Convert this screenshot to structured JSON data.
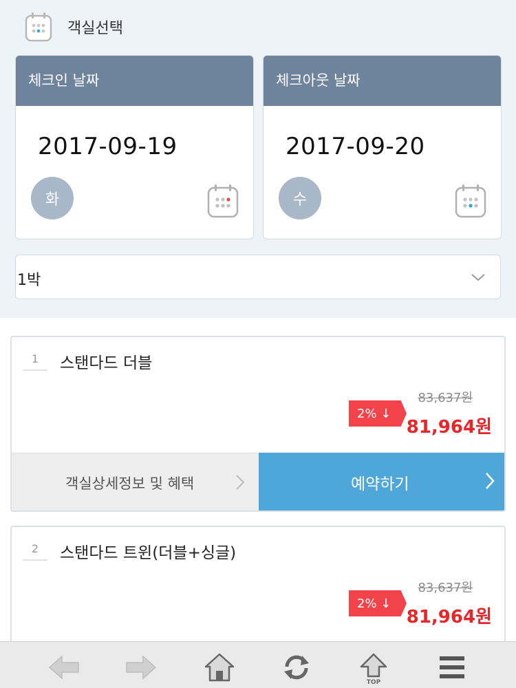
{
  "header": {
    "title": "객실선택",
    "icon": "calendar-icon"
  },
  "checkin": {
    "label": "체크인 날짜",
    "date": "2017-09-19",
    "weekday": "화"
  },
  "checkout": {
    "label": "체크아웃 날짜",
    "date": "2017-09-20",
    "weekday": "수"
  },
  "nights": {
    "selected": "1박"
  },
  "rooms": [
    {
      "number": "1",
      "name": "스탠다드 더블",
      "discount": "2% ↓",
      "original_price": "83,637원",
      "price": "81,964원",
      "detail_label": "객실상세정보 및 혜택",
      "reserve_label": "예약하기"
    },
    {
      "number": "2",
      "name": "스탠다드 트윈(더블+싱글)",
      "discount": "2% ↓",
      "original_price": "83,637원",
      "price": "81,964원"
    }
  ],
  "bottom_nav": {
    "top_label": "TOP",
    "icons": [
      "back-arrow-icon",
      "forward-arrow-icon",
      "home-icon",
      "refresh-icon",
      "top-arrow-icon",
      "menu-icon"
    ]
  },
  "colors": {
    "header_card": "#6e849c",
    "accent_blue": "#4fa6d9",
    "price_red": "#e5262b",
    "discount_red": "#f2434a"
  }
}
